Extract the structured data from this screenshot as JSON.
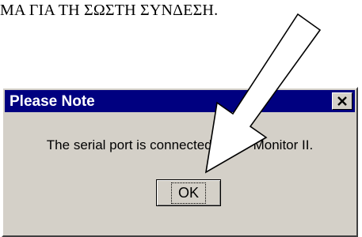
{
  "document": {
    "heading_fragment": "ΜΑ ΓΙΑ ΤΗ ΣΩΣΤΗ ΣΥΝΔΕΣΗ."
  },
  "dialog": {
    "title": "Please Note",
    "close_glyph": "✕",
    "message": "The serial port is connected to the Monitor II.",
    "ok_label": "OK"
  },
  "overlay": {
    "icon": "pointer-arrow-icon",
    "color": "#ffffff",
    "outline": "#000000"
  }
}
